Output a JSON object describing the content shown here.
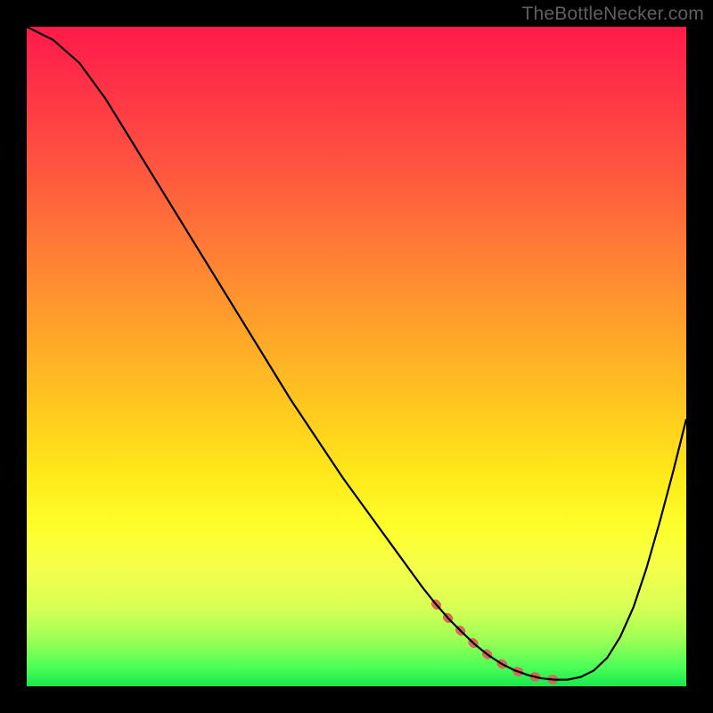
{
  "watermark": "TheBottleNecker.com",
  "colors": {
    "page_bg": "#000000",
    "curve": "#000000",
    "highlight_band": "#d9625b",
    "watermark_text": "#5f5f5f"
  },
  "chart_data": {
    "type": "line",
    "title": "",
    "xlabel": "",
    "ylabel": "",
    "xlim": [
      0,
      100
    ],
    "ylim": [
      0,
      100
    ],
    "x": [
      0,
      4,
      8,
      12,
      16,
      20,
      24,
      28,
      32,
      36,
      40,
      44,
      48,
      52,
      56,
      60,
      62,
      64,
      66,
      68,
      70,
      72,
      74,
      76,
      78,
      80,
      82,
      84,
      86,
      88,
      90,
      92,
      94,
      96,
      98,
      100
    ],
    "values": [
      100,
      98,
      94.5,
      89,
      82.5,
      76,
      69.5,
      63,
      56.5,
      50,
      43.5,
      37.5,
      31.5,
      26,
      20.5,
      15,
      12.5,
      10.2,
      8.2,
      6.3,
      4.7,
      3.4,
      2.4,
      1.7,
      1.2,
      1.0,
      1.0,
      1.4,
      2.4,
      4.3,
      7.5,
      12,
      18,
      25,
      32.5,
      40.5
    ],
    "highlight_range_x": [
      62,
      83
    ],
    "gradient_stops": [
      {
        "pos": 0,
        "color": "#ff1a4b"
      },
      {
        "pos": 8,
        "color": "#ff2f47"
      },
      {
        "pos": 20,
        "color": "#ff5140"
      },
      {
        "pos": 33,
        "color": "#ff7a36"
      },
      {
        "pos": 46,
        "color": "#ffa32a"
      },
      {
        "pos": 58,
        "color": "#ffc91f"
      },
      {
        "pos": 68,
        "color": "#ffe91a"
      },
      {
        "pos": 76,
        "color": "#fdff2c"
      },
      {
        "pos": 82,
        "color": "#f5ff4a"
      },
      {
        "pos": 88,
        "color": "#d8ff55"
      },
      {
        "pos": 93,
        "color": "#9cff55"
      },
      {
        "pos": 97,
        "color": "#4dff57"
      },
      {
        "pos": 100,
        "color": "#17e84e"
      }
    ]
  }
}
